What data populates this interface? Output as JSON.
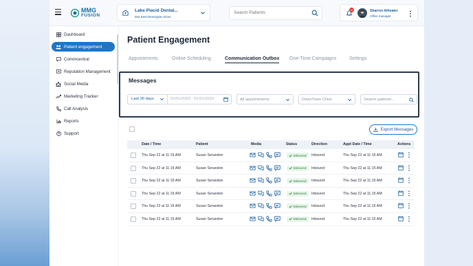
{
  "app": {
    "logo_line1": "MMG",
    "logo_line2": "FUSION"
  },
  "header": {
    "practice_name": "Lake Placid Dental...",
    "practice_address": "592 East Remington Drive",
    "search_placeholder": "Search Patients",
    "notification_count": "10",
    "user_name": "Sharron Atheater",
    "user_role": "Office manager"
  },
  "sidebar": {
    "items": [
      {
        "label": "Dashboard",
        "icon": "grid-icon"
      },
      {
        "label": "Patient engagement",
        "icon": "people-icon",
        "active": true
      },
      {
        "label": "Commcentral",
        "icon": "chat-icon"
      },
      {
        "label": "Reputation Management",
        "icon": "star-icon"
      },
      {
        "label": "Social Media",
        "icon": "share-icon"
      },
      {
        "label": "Marketing Tracker",
        "icon": "chart-icon"
      },
      {
        "label": "Call Analysis",
        "icon": "phone-icon"
      },
      {
        "label": "Reports",
        "icon": "report-icon"
      },
      {
        "label": "Support",
        "icon": "help-icon"
      }
    ]
  },
  "page": {
    "title": "Patient Engagement",
    "tabs": [
      {
        "label": "Appointments"
      },
      {
        "label": "Online Scheduling"
      },
      {
        "label": "Communication Outbox",
        "active": true
      },
      {
        "label": "One-Time Campaigns"
      },
      {
        "label": "Settings"
      }
    ]
  },
  "messages": {
    "title": "Messages",
    "date_preset": "Last 30 days",
    "date_range": "01/01/2023 - 01/31/2023",
    "appointments_filter": "All appointments",
    "clinic_filter": "DownTown Clinic",
    "patient_search_placeholder": "Search patients...",
    "export_label": "Export Messages"
  },
  "table": {
    "headers": {
      "datetime": "Date / Time",
      "patient": "Patient",
      "media": "Media",
      "status": "Status",
      "direction": "Direction",
      "appt": "Appt Date / Time",
      "actions": "Actions"
    },
    "rows": [
      {
        "datetime": "Thu Sep 22 at 11:15 AM",
        "patient": "Susan Serandon",
        "status": "Delivered",
        "direction": "Inbound",
        "appt": "Thu Sep 22 at 11:15 AM"
      },
      {
        "datetime": "Thu Sep 22 at 11:15 AM",
        "patient": "Susan Serandon",
        "status": "Delivered",
        "direction": "Inbound",
        "appt": "Thu Sep 22 at 11:15 AM"
      },
      {
        "datetime": "Thu Sep 22 at 11:15 AM",
        "patient": "Susan Serandon",
        "status": "Delivered",
        "direction": "Inbound",
        "appt": "Thu Sep 22 at 11:15 AM"
      },
      {
        "datetime": "Thu Sep 22 at 11:15 AM",
        "patient": "Susan Serandon",
        "status": "Delivered",
        "direction": "Inbound",
        "appt": "Thu Sep 22 at 11:15 AM"
      },
      {
        "datetime": "Thu Sep 22 at 11:15 AM",
        "patient": "Susan Serandon",
        "status": "Delivered",
        "direction": "Inbound",
        "appt": "Thu Sep 22 at 11:15 AM"
      },
      {
        "datetime": "Thu Sep 22 at 11:15 AM",
        "patient": "Susan Serandon",
        "status": "Delivered",
        "direction": "Inbound",
        "appt": "Thu Sep 22 at 11:15 AM"
      }
    ]
  },
  "colors": {
    "accent": "#1c77c8",
    "status_green": "#2e7d32",
    "frame_dark": "#2a3a4e"
  }
}
